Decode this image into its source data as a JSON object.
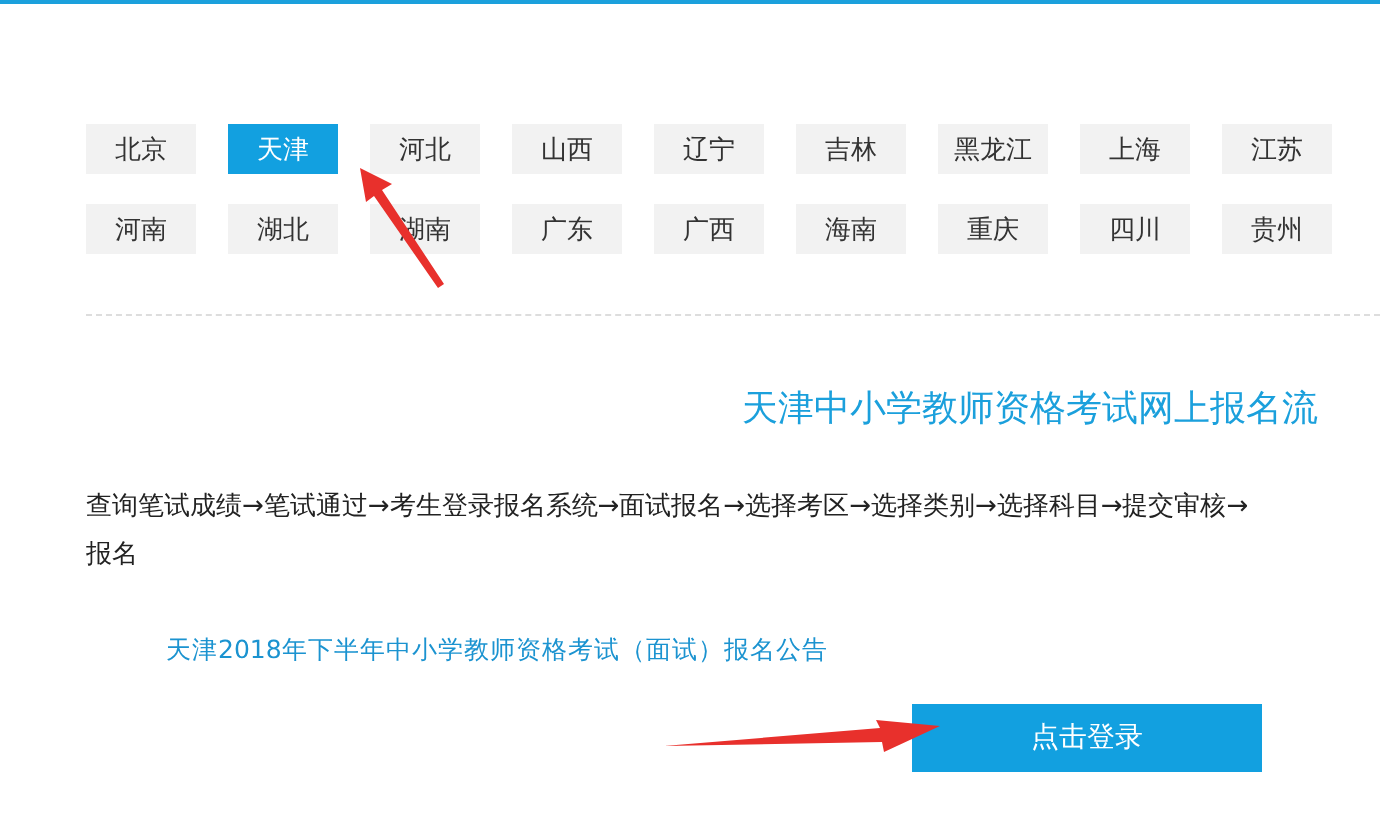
{
  "provinces": [
    {
      "label": "北京",
      "selected": false
    },
    {
      "label": "天津",
      "selected": true
    },
    {
      "label": "河北",
      "selected": false
    },
    {
      "label": "山西",
      "selected": false
    },
    {
      "label": "辽宁",
      "selected": false
    },
    {
      "label": "吉林",
      "selected": false
    },
    {
      "label": "黑龙江",
      "selected": false
    },
    {
      "label": "上海",
      "selected": false
    },
    {
      "label": "江苏",
      "selected": false
    },
    {
      "label": "河南",
      "selected": false
    },
    {
      "label": "湖北",
      "selected": false
    },
    {
      "label": "湖南",
      "selected": false
    },
    {
      "label": "广东",
      "selected": false
    },
    {
      "label": "广西",
      "selected": false
    },
    {
      "label": "海南",
      "selected": false
    },
    {
      "label": "重庆",
      "selected": false
    },
    {
      "label": "四川",
      "selected": false
    },
    {
      "label": "贵州",
      "selected": false
    }
  ],
  "title": "天津中小学教师资格考试网上报名流",
  "process_lines": [
    "查询笔试成绩→笔试通过→考生登录报名系统→面试报名→选择考区→选择类别→选择科目→提交审核→",
    "报名"
  ],
  "announcement_link": "天津2018年下半年中小学教师资格考试（面试）报名公告",
  "login_button": "点击登录"
}
